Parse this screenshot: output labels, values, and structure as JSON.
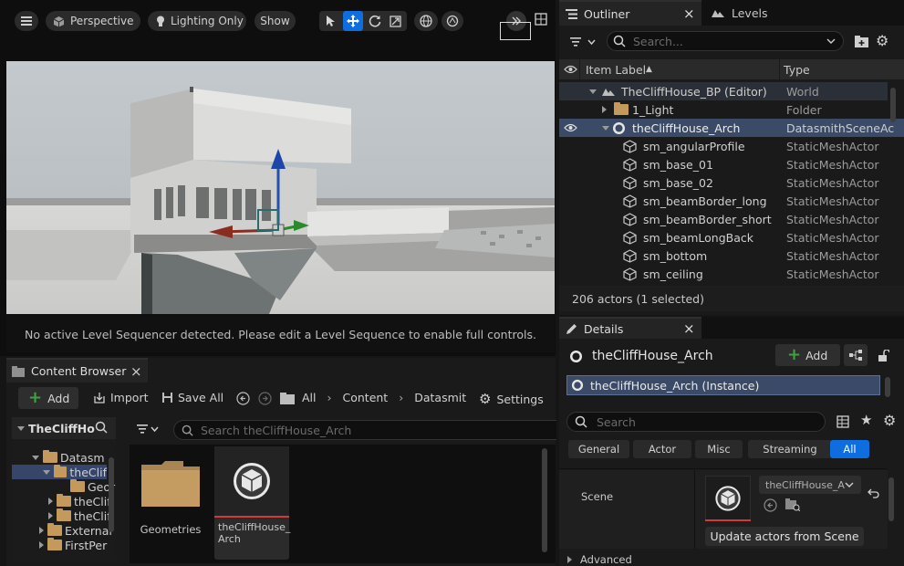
{
  "viewport": {
    "toolbar": {
      "menu_icon": "hamburger-icon",
      "perspective_label": "Perspective",
      "lighting_label": "Lighting Only",
      "show_label": "Show"
    },
    "sequencer_message": "No active Level Sequencer detected. Please edit a Level Sequence to enable full controls."
  },
  "content_browser": {
    "tab_label": "Content Browser",
    "add_label": "Add",
    "import_label": "Import",
    "save_all_label": "Save All",
    "breadcrumb": [
      "All",
      "Content",
      "Datasmit"
    ],
    "settings_label": "Settings",
    "tree_root_label": "TheCliffHo",
    "search_placeholder": "Search theCliffHouse_Arch",
    "tree_items": [
      {
        "label": "Datasm",
        "expanded": true
      },
      {
        "label": "theClif",
        "expanded": true,
        "selected": true
      },
      {
        "label": "Geor",
        "expanded": false
      },
      {
        "label": "theClif",
        "expanded": false
      },
      {
        "label": "theClif",
        "expanded": false
      },
      {
        "label": "External",
        "expanded": false
      },
      {
        "label": "FirstPer",
        "expanded": false
      }
    ],
    "assets": [
      {
        "label": "Geometries",
        "kind": "folder"
      },
      {
        "label": "theCliffHouse_\nArch",
        "kind": "datasmith-scene"
      }
    ]
  },
  "outliner": {
    "tab_label": "Outliner",
    "levels_tab_label": "Levels",
    "search_placeholder": "Search...",
    "col_item_label": "Item Label",
    "col_type": "Type",
    "rows": [
      {
        "label": "TheCliffHouse_BP (Editor)",
        "type": "World"
      },
      {
        "label": "1_Light",
        "type": "Folder"
      },
      {
        "label": "theCliffHouse_Arch",
        "type": "DatasmithSceneAc"
      },
      {
        "label": "sm_angularProfile",
        "type": "StaticMeshActor"
      },
      {
        "label": "sm_base_01",
        "type": "StaticMeshActor"
      },
      {
        "label": "sm_base_02",
        "type": "StaticMeshActor"
      },
      {
        "label": "sm_beamBorder_long",
        "type": "StaticMeshActor"
      },
      {
        "label": "sm_beamBorder_short",
        "type": "StaticMeshActor"
      },
      {
        "label": "sm_beamLongBack",
        "type": "StaticMeshActor"
      },
      {
        "label": "sm_bottom",
        "type": "StaticMeshActor"
      },
      {
        "label": "sm_ceiling",
        "type": "StaticMeshActor"
      }
    ],
    "footer": "206 actors (1 selected)"
  },
  "details": {
    "tab_label": "Details",
    "actor_name": "theCliffHouse_Arch",
    "add_label": "Add",
    "instance_label": "theCliffHouse_Arch (Instance)",
    "search_placeholder": "Search",
    "filters": [
      "General",
      "Actor",
      "Misc",
      "Streaming",
      "All"
    ],
    "active_filter": "All",
    "scene_label": "Scene",
    "scene_asset_value": "theCliffHouse_A",
    "update_button": "Update actors from Scene",
    "advanced_label": "Advanced"
  },
  "colors": {
    "accent_blue": "#0e6ee0",
    "selection_row": "#3b4a66",
    "add_green": "#3ea33e"
  }
}
